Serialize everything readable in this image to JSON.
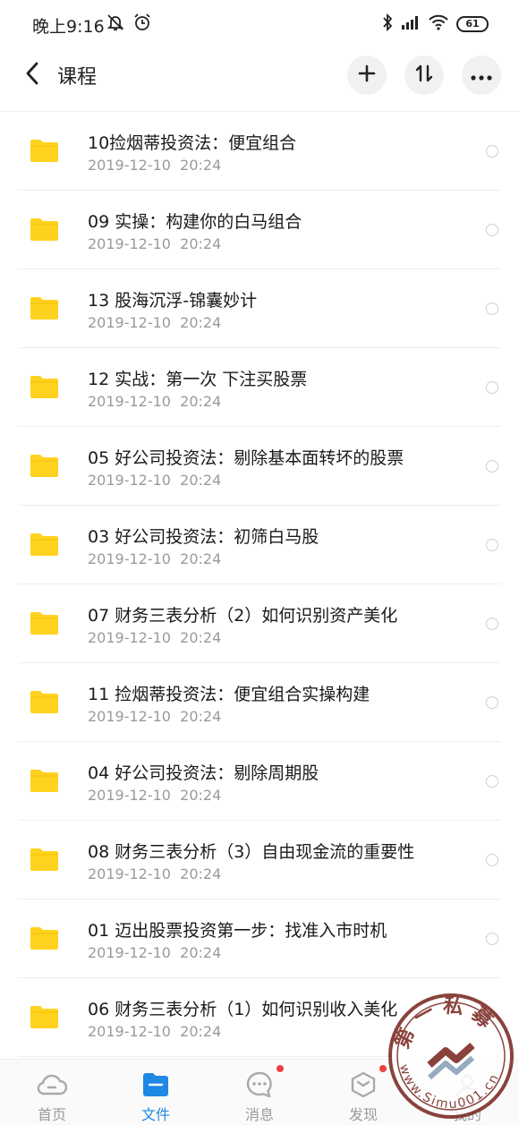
{
  "status_bar": {
    "time": "晚上9:16",
    "battery": "61",
    "icons": [
      "mute-bell-icon",
      "alarm-icon",
      "bluetooth-icon",
      "signal-icon",
      "wifi-icon",
      "battery-icon"
    ]
  },
  "header": {
    "title": "课程",
    "icons": [
      "back-arrow-icon",
      "plus-icon",
      "sort-icon",
      "more-dots-icon"
    ]
  },
  "files": [
    {
      "name": "10捡烟蒂投资法：便宜组合",
      "date": "2019-12-10  20:24"
    },
    {
      "name": "09 实操：构建你的白马组合",
      "date": "2019-12-10  20:24"
    },
    {
      "name": "13 股海沉浮-锦囊妙计",
      "date": "2019-12-10  20:24"
    },
    {
      "name": "12  实战：第一次 下注买股票",
      "date": "2019-12-10  20:24"
    },
    {
      "name": "05 好公司投资法：剔除基本面转坏的股票",
      "date": "2019-12-10  20:24"
    },
    {
      "name": "03 好公司投资法：初筛白马股",
      "date": "2019-12-10  20:24"
    },
    {
      "name": "07 财务三表分析（2）如何识别资产美化",
      "date": "2019-12-10  20:24"
    },
    {
      "name": "11 捡烟蒂投资法：便宜组合实操构建",
      "date": "2019-12-10  20:24"
    },
    {
      "name": "04 好公司投资法：剔除周期股",
      "date": "2019-12-10  20:24"
    },
    {
      "name": "08 财务三表分析（3）自由现金流的重要性",
      "date": "2019-12-10  20:24"
    },
    {
      "name": "01 迈出股票投资第一步：找准入市时机",
      "date": "2019-12-10  20:24"
    },
    {
      "name": "06 财务三表分析（1）如何识别收入美化",
      "date": "2019-12-10  20:24"
    }
  ],
  "nav": {
    "home": "首页",
    "files": "文件",
    "messages": "消息",
    "discover": "发现",
    "mine": "我的"
  },
  "watermark": {
    "top_text": "第一私募",
    "bottom_text": "www.Simu001.cn"
  },
  "colors": {
    "accent": "#1e88e5",
    "folder": "#ffd21f",
    "badge": "#f04141"
  }
}
